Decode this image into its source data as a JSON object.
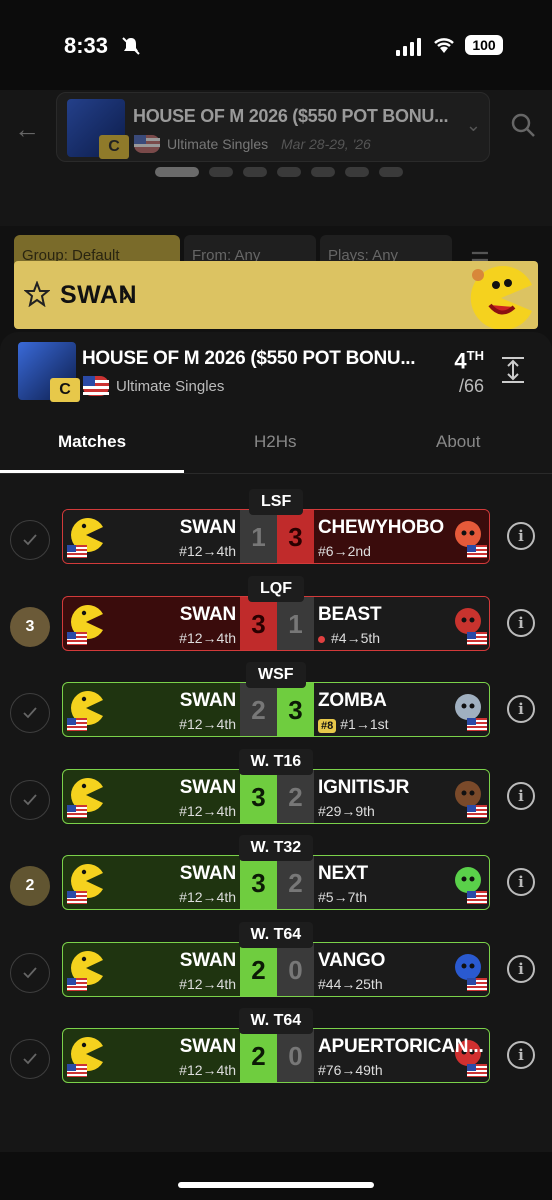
{
  "status": {
    "time": "8:33",
    "battery": "100"
  },
  "top_card": {
    "name": "HOUSE OF M 2026 ($550 POT BONU...",
    "tier": "C",
    "game": "Ultimate Singles",
    "dates": "Mar 28-29, '26"
  },
  "filters": {
    "group": "Group: Default",
    "from": "From: Any",
    "plays": "Plays: Any"
  },
  "banner": {
    "player": "SWAN",
    "accent": "#dcc362"
  },
  "header": {
    "name": "HOUSE OF M 2026 ($550 POT BONU...",
    "tier": "C",
    "game": "Ultimate Singles",
    "rank": "4",
    "rank_suffix": "TH",
    "total": "/66"
  },
  "tabs": [
    "Matches",
    "H2Hs",
    "About"
  ],
  "matches": [
    {
      "round": "LSF",
      "lead": "check",
      "left_name": "SWAN",
      "left_seed": "#12→4th",
      "left_score": "1",
      "right_score": "3",
      "right_name": "CHEWYHOBO",
      "right_seed": "#6→2nd",
      "result": "loss"
    },
    {
      "round": "LQF",
      "lead": "3",
      "left_name": "SWAN",
      "left_seed": "#12→4th",
      "left_score": "3",
      "right_score": "1",
      "right_name": "BEAST",
      "right_seed": "#4→5th",
      "result": "loss-l"
    },
    {
      "round": "WSF",
      "lead": "check",
      "left_name": "SWAN",
      "left_seed": "#12→4th",
      "left_score": "2",
      "right_score": "3",
      "right_name": "ZOMBA",
      "right_seed": "#1→1st",
      "right_badge": "#8",
      "result": "win-r"
    },
    {
      "round": "W. T16",
      "lead": "check",
      "left_name": "SWAN",
      "left_seed": "#12→4th",
      "left_score": "3",
      "right_score": "2",
      "right_name": "IGNITISJR",
      "right_seed": "#29→9th",
      "result": "win"
    },
    {
      "round": "W. T32",
      "lead": "2",
      "left_name": "SWAN",
      "left_seed": "#12→4th",
      "left_score": "3",
      "right_score": "2",
      "right_name": "NEXT",
      "right_seed": "#5→7th",
      "result": "win"
    },
    {
      "round": "W. T64",
      "lead": "check",
      "left_name": "SWAN",
      "left_seed": "#12→4th",
      "left_score": "2",
      "right_score": "0",
      "right_name": "VANGO",
      "right_seed": "#44→25th",
      "result": "win"
    },
    {
      "round": "W. T64",
      "lead": "check",
      "left_name": "SWAN",
      "left_seed": "#12→4th",
      "left_score": "2",
      "right_score": "0",
      "right_name": "APUERTORICAN...",
      "right_seed": "#76→49th",
      "result": "win"
    }
  ],
  "icons": {
    "back": "arrow-left-icon",
    "search": "search-icon",
    "star": "star-icon",
    "expand": "expand-icon",
    "info": "info-icon",
    "check": "check-icon"
  }
}
